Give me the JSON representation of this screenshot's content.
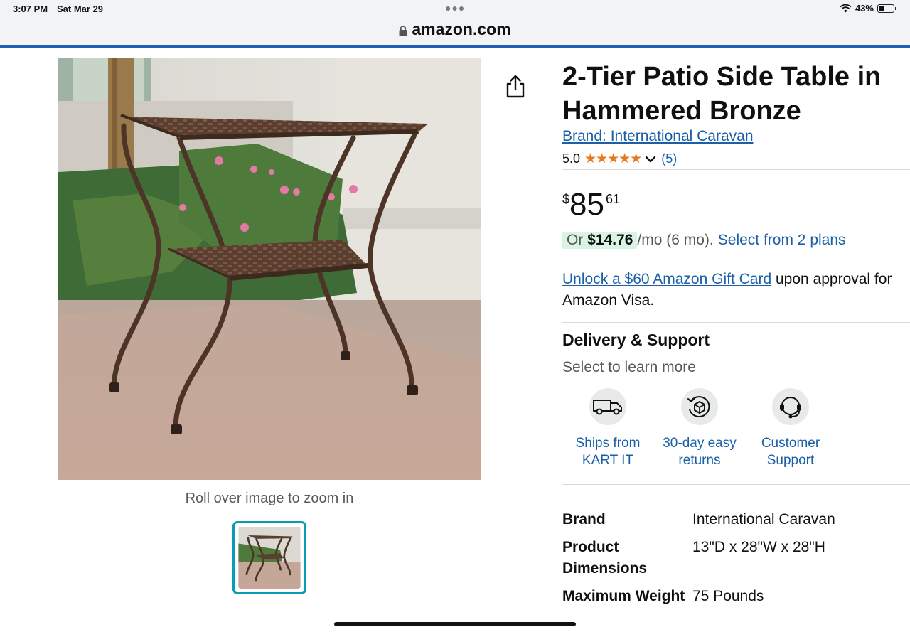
{
  "status_bar": {
    "time": "3:07 PM",
    "date": "Sat Mar 29",
    "battery_percent": "43%",
    "battery_level": 0.43,
    "icons": [
      "more-dots-icon",
      "wifi-icon",
      "battery-icon"
    ]
  },
  "browser": {
    "url": "amazon.com",
    "lock_icon": "lock-icon",
    "load_progress": 1.0
  },
  "product": {
    "title": "2-Tier Patio Side Table in Hammered Bronze",
    "brand_link": "Brand: International Caravan",
    "rating": "5.0",
    "stars": "★★★★★",
    "review_count": "(5)",
    "price": {
      "symbol": "$",
      "whole": "85",
      "fraction": "61"
    },
    "monthly": {
      "prefix": "Or",
      "amount": "$14.76",
      "suffix": "/mo (6 mo).",
      "plans_link": "Select from 2 plans"
    },
    "gift_card": {
      "link": "Unlock a $60 Amazon Gift Card",
      "text": " upon approval for Amazon Visa."
    }
  },
  "gallery": {
    "zoom_hint": "Roll over image to zoom in",
    "share_icon": "share-icon"
  },
  "delivery": {
    "title": "Delivery & Support",
    "subtitle": "Select to learn more",
    "features": [
      {
        "icon": "delivery-van-icon",
        "line1": "Ships from",
        "line2": "KART IT"
      },
      {
        "icon": "returns-box-icon",
        "line1": "30-day easy",
        "line2": "returns"
      },
      {
        "icon": "headset-icon",
        "line1": "Customer",
        "line2": "Support"
      }
    ]
  },
  "specs": [
    {
      "key": "Brand",
      "value": "International Caravan"
    },
    {
      "key": "Product Dimensions",
      "value": "13\"D x 28\"W x 28\"H"
    },
    {
      "key": "Maximum Weight",
      "value": "75 Pounds"
    }
  ],
  "colors": {
    "link": "#1a5fa8",
    "star": "#e77a1e",
    "thumb_border": "#0a9bb6",
    "monthly_highlight": "#d9f3e4"
  }
}
